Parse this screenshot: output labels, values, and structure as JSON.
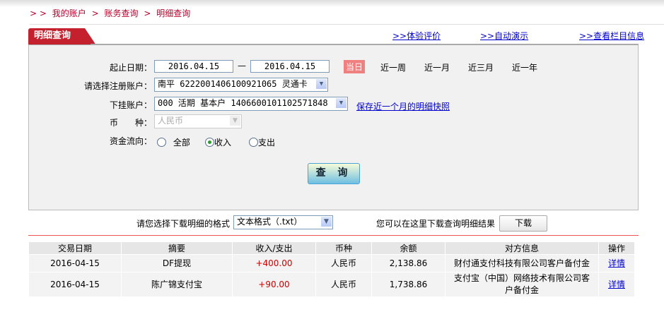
{
  "breadcrumb": {
    "prefix": "> >",
    "items": [
      "我的账户",
      "账务查询",
      "明细查询"
    ],
    "sep": ">"
  },
  "tab_title": "明细查询",
  "top_links": [
    ">>体验评价",
    ">>自动演示",
    ">>查看栏目信息"
  ],
  "form": {
    "date_label": "起止日期：",
    "start_date": "2016.04.15",
    "dash": "—",
    "end_date": "2016.04.15",
    "ranges": [
      "当日",
      "近一周",
      "近一月",
      "近三月",
      "近一年"
    ],
    "reg_account_label": "请选择注册账户：",
    "reg_account_value": "南平 6222001406100921065 灵通卡",
    "sub_account_label": "下挂账户：",
    "sub_account_value": "000 活期 基本户 1406600101102571848",
    "snapshot_link": "保存近一个月的明细快照",
    "currency_label": "币　　种：",
    "currency_value": "人民币",
    "flow_label": "资金流向：",
    "flow_options": [
      "全部",
      "收入",
      "支出"
    ],
    "flow_selected": "收入",
    "query_button": "查 询"
  },
  "download": {
    "format_label": "请您选择下载明细的格式",
    "format_value": "文本格式（.txt）",
    "hint": "您可以在这里下载查询明细结果",
    "button": "下载"
  },
  "table": {
    "headers": [
      "交易日期",
      "摘要",
      "收入/支出",
      "币种",
      "余额",
      "对方信息",
      "操作"
    ],
    "rows": [
      [
        "2016-04-15",
        "DF提现",
        "+400.00",
        "人民币",
        "2,138.86",
        "财付通支付科技有限公司客户备付金",
        "详情"
      ],
      [
        "2016-04-15",
        "陈广锦支付宝",
        "+90.00",
        "人民币",
        "1,738.86",
        "支付宝（中国）网络技术有限公司客户备付金",
        "详情"
      ]
    ]
  },
  "colors": {
    "brand_red": "#c4202e",
    "link": "#0000cc",
    "amount": "#cc0000"
  }
}
